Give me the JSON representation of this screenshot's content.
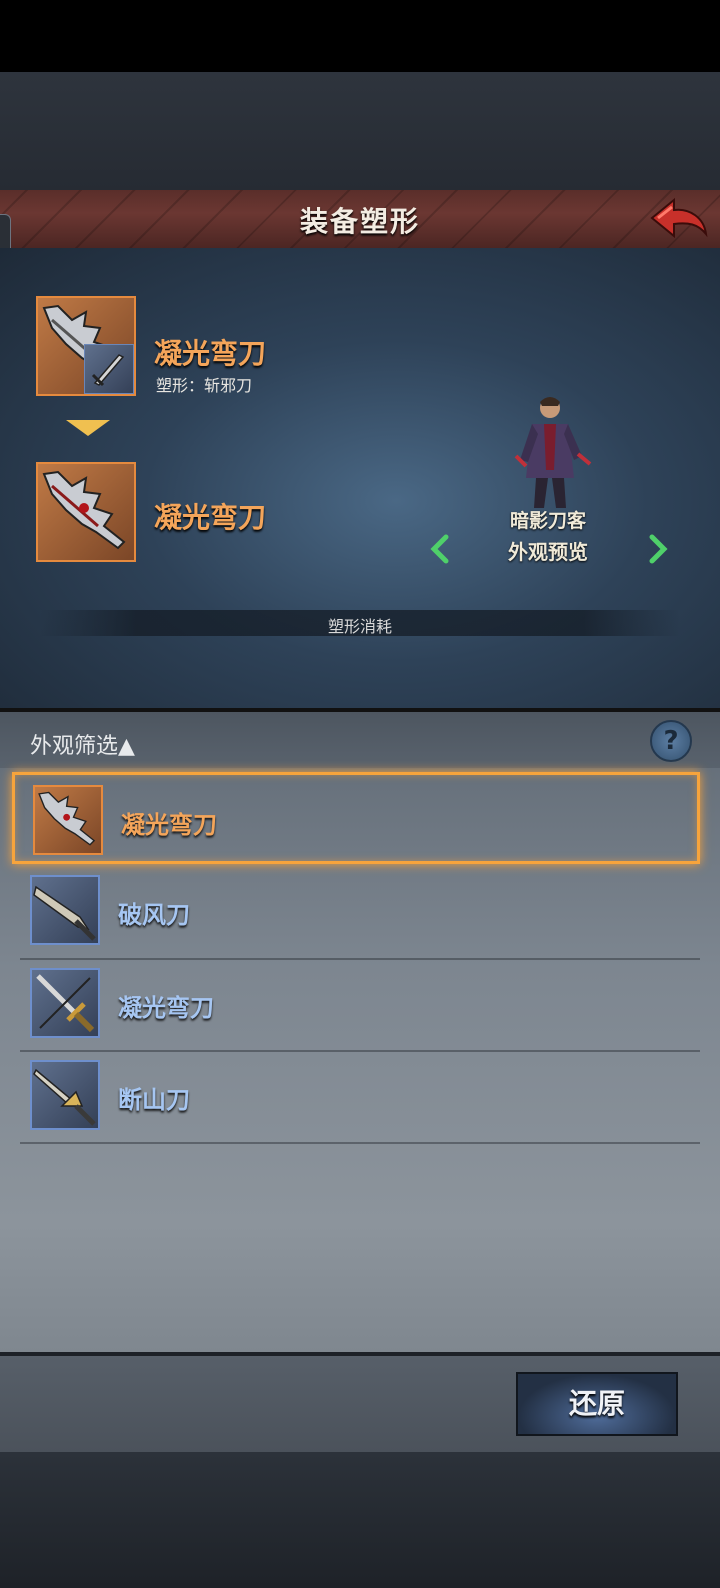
{
  "header": {
    "title": "装备塑形"
  },
  "current_equipment": {
    "name": "凝光弯刀",
    "shape_label": "塑形：斩邪刀"
  },
  "new_equipment": {
    "name": "凝光弯刀"
  },
  "character": {
    "name": "暗影刀客",
    "preview_label": "外观预览"
  },
  "cost": {
    "label": "塑形消耗"
  },
  "filter": {
    "label": "外观筛选▲",
    "help": "?"
  },
  "appearance_list": [
    {
      "name": "凝光弯刀",
      "selected": true,
      "rarity_color": "#e58a3e"
    },
    {
      "name": "破风刀",
      "selected": false,
      "rarity_color": "#6e8fcc"
    },
    {
      "name": "凝光弯刀",
      "selected": false,
      "rarity_color": "#6e8fcc"
    },
    {
      "name": "断山刀",
      "selected": false,
      "rarity_color": "#6e8fcc"
    }
  ],
  "footer": {
    "restore_label": "还原"
  },
  "colors": {
    "accent_orange": "#f4a55a",
    "item_blue": "#a6c6f2",
    "header_red": "#6b3732"
  }
}
